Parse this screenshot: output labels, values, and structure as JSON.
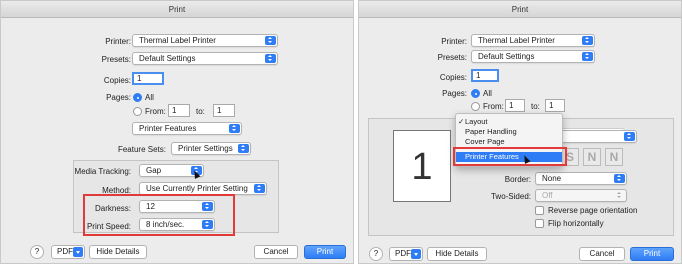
{
  "left": {
    "title": "Print",
    "printer": {
      "label": "Printer:",
      "value": "Thermal Label Printer"
    },
    "presets": {
      "label": "Presets:",
      "value": "Default Settings"
    },
    "copies": {
      "label": "Copies:",
      "value": "1"
    },
    "pages": {
      "label": "Pages:",
      "all": "All",
      "from_label": "From:",
      "from_value": "1",
      "to_label": "to:",
      "to_value": "1"
    },
    "section": {
      "value": "Printer Features"
    },
    "feature_sets": {
      "label": "Feature Sets:",
      "value": "Printer Settings"
    },
    "media_tracking": {
      "label": "Media Tracking:",
      "value": "Gap"
    },
    "method": {
      "label": "Method:",
      "value": "Use Currently Printer Setting"
    },
    "darkness": {
      "label": "Darkness:",
      "value": "12"
    },
    "print_speed": {
      "label": "Print Speed:",
      "value": "8 inch/sec."
    },
    "footer": {
      "help": "?",
      "pdf": "PDF",
      "hide_details": "Hide Details",
      "cancel": "Cancel",
      "print": "Print"
    }
  },
  "right": {
    "title": "Print",
    "printer": {
      "label": "Printer:",
      "value": "Thermal Label Printer"
    },
    "presets": {
      "label": "Presets:",
      "value": "Default Settings"
    },
    "copies": {
      "label": "Copies:",
      "value": "1"
    },
    "pages": {
      "label": "Pages:",
      "all": "All",
      "from_label": "From:",
      "from_value": "1",
      "to_label": "to:",
      "to_value": "1"
    },
    "menu": {
      "items": [
        {
          "label": "Layout",
          "checked": true
        },
        {
          "label": "Paper Handling"
        },
        {
          "label": "Cover Page"
        },
        {
          "label": "Printer Features",
          "selected": true
        }
      ]
    },
    "preview_page": "1",
    "border": {
      "label": "Border:",
      "value": "None"
    },
    "two_sided": {
      "label": "Two-Sided:",
      "value": "Off"
    },
    "reverse_orientation": {
      "label": "Reverse page orientation"
    },
    "flip_horizontally": {
      "label": "Flip horizontally"
    },
    "footer": {
      "help": "?",
      "pdf": "PDF",
      "hide_details": "Hide Details",
      "cancel": "Cancel",
      "print": "Print"
    }
  },
  "colors": {
    "accent": "#2f7df6",
    "highlight_box": "#e03a3a",
    "dialog_bg": "#ececec"
  },
  "icons": [
    "help-icon",
    "popup-arrow-icon",
    "checkmark-icon",
    "mouse-pointer-icon",
    "layout-direction-icon"
  ]
}
